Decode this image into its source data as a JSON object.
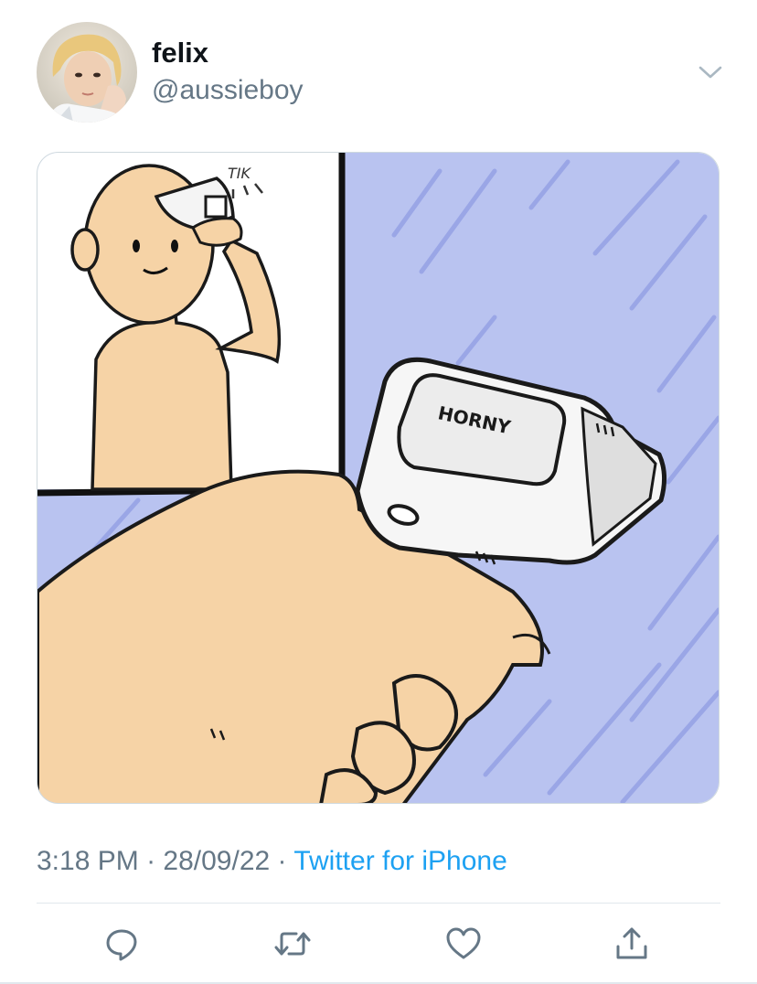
{
  "tweet": {
    "display_name": "felix",
    "handle": "@aussieboy",
    "time": "3:18 PM",
    "separator": "·",
    "date": "28/09/22",
    "client": "Twitter for iPhone"
  },
  "media": {
    "thermometer_text": "HORNY",
    "sfx_text": "TIK"
  },
  "icons": {
    "caret": "chevron-down-icon",
    "reply": "reply-icon",
    "retweet": "retweet-icon",
    "like": "heart-icon",
    "share": "share-icon"
  },
  "colors": {
    "link": "#1da1f2",
    "secondary_text": "#657786",
    "icon": "#657786",
    "comic_background": "#b9c3f0"
  }
}
